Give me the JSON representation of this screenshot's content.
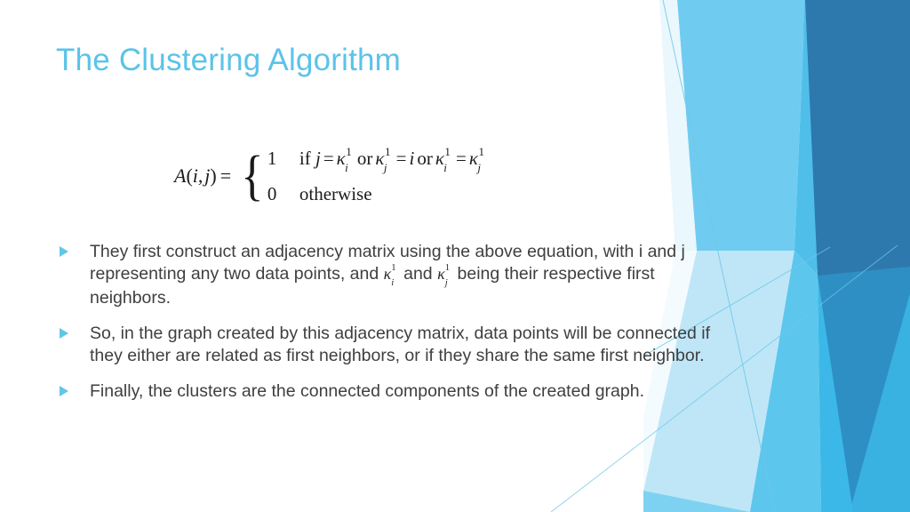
{
  "slide": {
    "title": "The Clustering Algorithm",
    "title_color": "#5BC3E8",
    "background_color": "#FFFFFF",
    "body_text_color": "#3F3F3F",
    "bullet_marker_color": "#62C6E8"
  },
  "equation": {
    "lhs_a": "A",
    "lhs_open": "(",
    "lhs_i": "i",
    "lhs_comma": ",",
    "lhs_j": "j",
    "lhs_close": ")",
    "equals": "=",
    "brace": "{",
    "case1_value": "1",
    "case1_if": "if",
    "case1_j": "j",
    "case1_eq1": "=",
    "case1_kappa1_k": "κ",
    "case1_kappa1_sup": "1",
    "case1_kappa1_sub": "i",
    "case1_or1": "or",
    "case1_kappa2_k": "κ",
    "case1_kappa2_sup": "1",
    "case1_kappa2_sub": "j",
    "case1_eq2": "=",
    "case1_i": "i",
    "case1_or2": "or",
    "case1_kappa3_k": "κ",
    "case1_kappa3_sup": "1",
    "case1_kappa3_sub": "i",
    "case1_eq3": "=",
    "case1_kappa4_k": "κ",
    "case1_kappa4_sup": "1",
    "case1_kappa4_sub": "j",
    "case2_value": "0",
    "case2_text": "otherwise",
    "plain_text": "A(i, j) = { 1 if j = κ¹ᵢ or κ¹ⱼ = i or κ¹ᵢ = κ¹ⱼ ; 0 otherwise }"
  },
  "bullets": [
    {
      "marker": "triangle-right",
      "part1": "They first construct an adjacency matrix using the above equation, with i and j representing any two data points, and ",
      "kappa1_k": "κ",
      "kappa1_sup": "1",
      "kappa1_sub": "i",
      "part2": " and ",
      "kappa2_k": "κ",
      "kappa2_sup": "1",
      "kappa2_sub": "j",
      "part3": " being their respective first neighbors."
    },
    {
      "marker": "triangle-right",
      "part1": "So, in the graph created by this adjacency matrix, data points will be connected if they either are related as first neighbors, or if they share the same first neighbor."
    },
    {
      "marker": "triangle-right",
      "part1": "Finally, the clusters are the connected components of the created graph."
    }
  ],
  "decoration": {
    "name": "facet-diagonal-shapes",
    "colors": {
      "dark_blue": "#2D79AE",
      "steel_blue": "#2E8FC4",
      "mid_cyan": "#3BB8E8",
      "sky_cyan": "#5CC6ED",
      "light_cyan": "#79D0F0",
      "pale_cyan": "#BFE6F7",
      "very_pale": "#DCF0FA",
      "hairline": "#6FC7E8"
    }
  }
}
